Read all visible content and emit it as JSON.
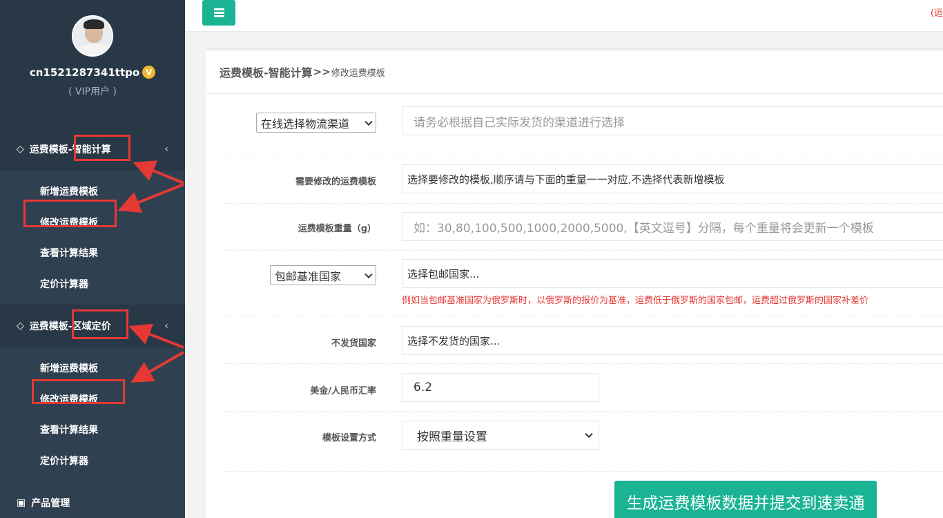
{
  "user": {
    "name": "cn1521287341ttpo",
    "badge": "V",
    "role": "( VIP用户 )"
  },
  "sidebar": {
    "groups": [
      {
        "title_prefix": "运费模板-",
        "title_highlight": "智能计算",
        "icon": "diamond-icon",
        "items": [
          {
            "label": "新增运费模板"
          },
          {
            "label": "修改运费模板"
          },
          {
            "label": "查看计算结果"
          },
          {
            "label": "定价计算器"
          }
        ]
      },
      {
        "title_prefix": "运费模板-",
        "title_highlight": "区域定价",
        "icon": "diamond-icon",
        "items": [
          {
            "label": "新增运费模板"
          },
          {
            "label": "修改运费模板"
          },
          {
            "label": "查看计算结果"
          },
          {
            "label": "定价计算器"
          }
        ]
      }
    ],
    "product": {
      "label": "产品管理",
      "icon": "cube-icon"
    }
  },
  "topbar": {
    "note": "(运"
  },
  "panel": {
    "title_main": "运费模板-智能计算",
    "title_sep": ">>",
    "title_sub": "修改运费模板"
  },
  "form": {
    "channel_select": "在线选择物流渠道",
    "channel_placeholder": "请务必根据自己实际发货的渠道进行选择",
    "template_label": "需要修改的运费模板",
    "template_placeholder": "选择要修改的模板,顺序请与下面的重量一一对应,不选择代表新增模板",
    "weight_label": "运费模板重量（g）",
    "weight_placeholder": "如：30,80,100,500,1000,2000,5000,【英文逗号】分隔，每个重量将会更新一个模板",
    "base_country_select": "包邮基准国家",
    "base_country_placeholder": "选择包邮国家...",
    "base_country_hint": "例如当包邮基准国家为俄罗斯时，以俄罗斯的报价为基准，运费低于俄罗斯的国家包邮，运费超过俄罗斯的国家补差价",
    "no_ship_label": "不发货国家",
    "no_ship_placeholder": "选择不发货的国家...",
    "rate_label": "美金/人民币汇率",
    "rate_value": "6.2",
    "mode_label": "模板设置方式",
    "mode_value": "按照重量设置",
    "submit_label": "生成运费模板数据并提交到速卖通"
  }
}
